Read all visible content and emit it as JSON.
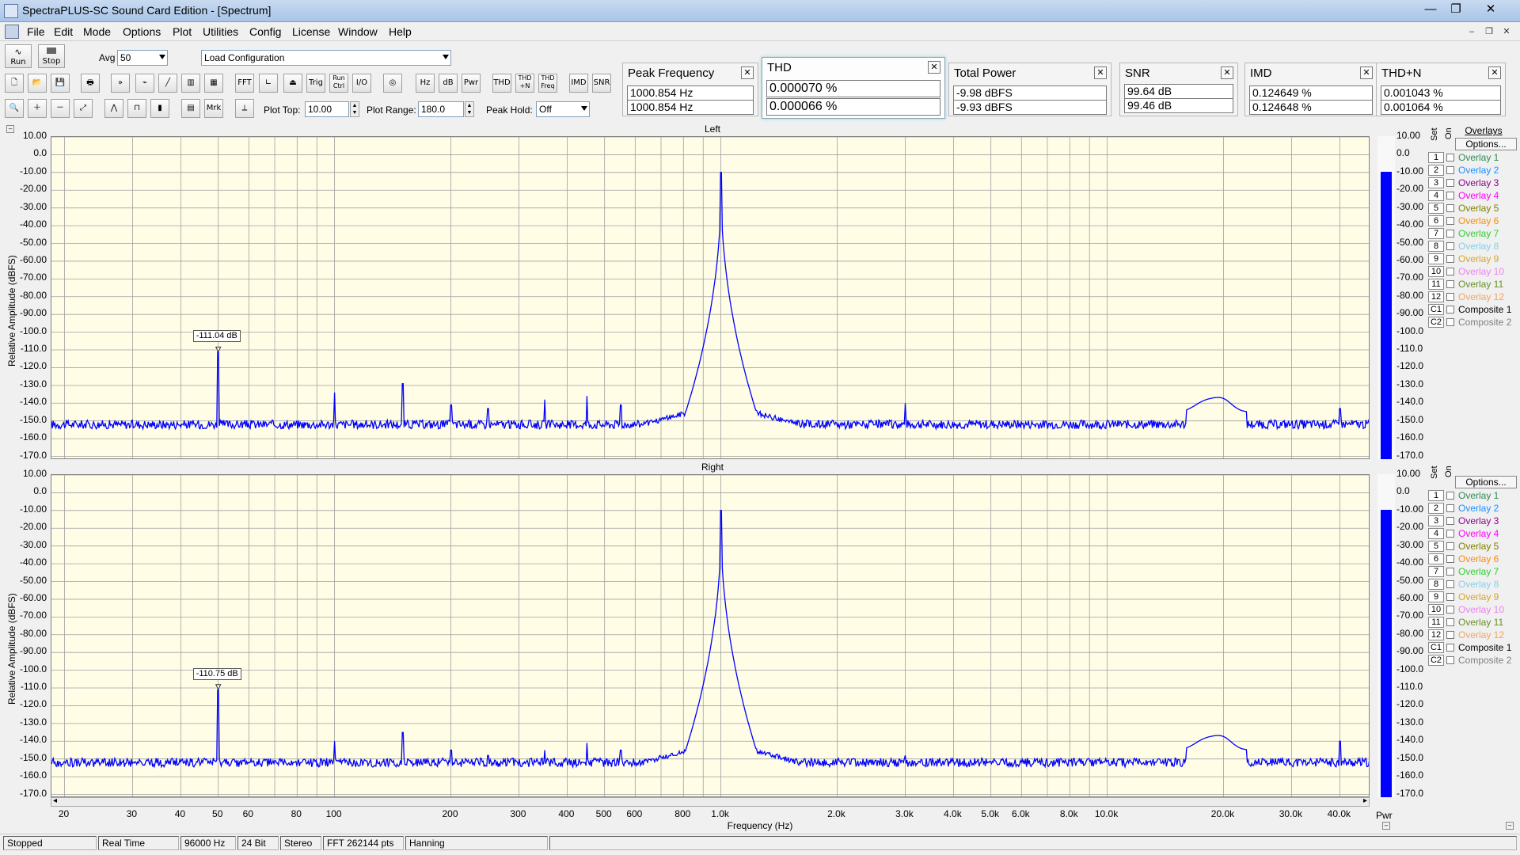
{
  "window": {
    "title": "SpectraPLUS-SC Sound Card Edition - [Spectrum]",
    "controls": [
      "—",
      "❐",
      "✕"
    ]
  },
  "menu": [
    "File",
    "Edit",
    "Mode",
    "Options",
    "Plot",
    "Utilities",
    "Config",
    "License",
    "Window",
    "Help"
  ],
  "toolbar": {
    "run_label": "Run",
    "stop_label": "Stop",
    "avg_label": "Avg",
    "avg_value": "50",
    "config_value": "Load Configuration",
    "fft_label": "FFT",
    "trig_label": "Trig",
    "runctrl_label": "Run Ctrl",
    "io_label": "I/O",
    "hz_label": "Hz",
    "db_label": "dB",
    "pwr_label": "Pwr",
    "thd_label": "THD",
    "thdn_label": "THD +N",
    "thdfreq_label": "THD Freq",
    "imd_label": "IMD",
    "snr_label": "SNR",
    "mrk_label": "Mrk",
    "plot_top_label": "Plot Top:",
    "plot_top_value": "10.00",
    "plot_range_label": "Plot Range:",
    "plot_range_value": "180.0",
    "peak_hold_label": "Peak Hold:",
    "peak_hold_value": "Off"
  },
  "meters": [
    {
      "title": "Peak Frequency",
      "v1": "1000.854 Hz",
      "v2": "1000.854 Hz"
    },
    {
      "title": "THD",
      "v1": "0.000070 %",
      "v2": "0.000066 %"
    },
    {
      "title": "Total Power",
      "v1": "-9.98 dBFS",
      "v2": "-9.93 dBFS"
    },
    {
      "title": "SNR",
      "v1": "99.64 dB",
      "v2": "99.46 dB"
    },
    {
      "title": "IMD",
      "v1": "0.124649 %",
      "v2": "0.124648 %"
    },
    {
      "title": "THD+N",
      "v1": "0.001043 %",
      "v2": "0.001064 %"
    }
  ],
  "plots": [
    {
      "title": "Left",
      "ylabel": "Relative Amplitude (dBFS)",
      "marker": "-111.04 dB",
      "marker_db": -111.04,
      "pwr_level_db": -10
    },
    {
      "title": "Right",
      "ylabel": "Relative Amplitude (dBFS)",
      "marker": "-110.75 dB",
      "marker_db": -110.75,
      "pwr_level_db": -10
    }
  ],
  "yticks": [
    "10.00",
    "0.0",
    "-10.00",
    "-20.00",
    "-30.00",
    "-40.00",
    "-50.00",
    "-60.00",
    "-70.00",
    "-80.00",
    "-90.00",
    "-100.0",
    "-110.0",
    "-120.0",
    "-130.0",
    "-140.0",
    "-150.0",
    "-160.0",
    "-170.0"
  ],
  "pwr_ticks": [
    "10.00",
    "0.0",
    "-10.00",
    "-20.00",
    "-30.00",
    "-40.00",
    "-50.00",
    "-60.00",
    "-70.00",
    "-80.00",
    "-90.00",
    "-100.0",
    "-110.0",
    "-120.0",
    "-130.0",
    "-140.0",
    "-150.0",
    "-160.0",
    "-170.0"
  ],
  "xticks": [
    {
      "label": "20",
      "f": 20
    },
    {
      "label": "30",
      "f": 30
    },
    {
      "label": "40",
      "f": 40
    },
    {
      "label": "50",
      "f": 50
    },
    {
      "label": "60",
      "f": 60
    },
    {
      "label": "80",
      "f": 80
    },
    {
      "label": "100",
      "f": 100
    },
    {
      "label": "200",
      "f": 200
    },
    {
      "label": "300",
      "f": 300
    },
    {
      "label": "400",
      "f": 400
    },
    {
      "label": "500",
      "f": 500
    },
    {
      "label": "600",
      "f": 600
    },
    {
      "label": "800",
      "f": 800
    },
    {
      "label": "1.0k",
      "f": 1000
    },
    {
      "label": "2.0k",
      "f": 2000
    },
    {
      "label": "3.0k",
      "f": 3000
    },
    {
      "label": "4.0k",
      "f": 4000
    },
    {
      "label": "5.0k",
      "f": 5000
    },
    {
      "label": "6.0k",
      "f": 6000
    },
    {
      "label": "8.0k",
      "f": 8000
    },
    {
      "label": "10.0k",
      "f": 10000
    },
    {
      "label": "20.0k",
      "f": 20000
    },
    {
      "label": "30.0k",
      "f": 30000
    },
    {
      "label": "40.0k",
      "f": 40000
    }
  ],
  "xlabel": "Frequency (Hz)",
  "pwr_label": "Pwr",
  "overlay_header": {
    "set": "Set",
    "on": "On",
    "title": "Overlays",
    "options": "Options..."
  },
  "overlays": [
    {
      "num": "1",
      "label": "Overlay 1",
      "color": "#2e8b57"
    },
    {
      "num": "2",
      "label": "Overlay 2",
      "color": "#1e90ff"
    },
    {
      "num": "3",
      "label": "Overlay 3",
      "color": "#8b008b"
    },
    {
      "num": "4",
      "label": "Overlay 4",
      "color": "#ff00ff"
    },
    {
      "num": "5",
      "label": "Overlay 5",
      "color": "#808000"
    },
    {
      "num": "6",
      "label": "Overlay 6",
      "color": "#ff8c00"
    },
    {
      "num": "7",
      "label": "Overlay 7",
      "color": "#32cd32"
    },
    {
      "num": "8",
      "label": "Overlay 8",
      "color": "#87ceeb"
    },
    {
      "num": "9",
      "label": "Overlay 9",
      "color": "#daa520"
    },
    {
      "num": "10",
      "label": "Overlay 10",
      "color": "#ee82ee"
    },
    {
      "num": "11",
      "label": "Overlay 11",
      "color": "#6b8e23"
    },
    {
      "num": "12",
      "label": "Overlay 12",
      "color": "#f4a460"
    },
    {
      "num": "C1",
      "label": "Composite 1",
      "color": "#000000"
    },
    {
      "num": "C2",
      "label": "Composite 2",
      "color": "#808080"
    }
  ],
  "status": [
    "Stopped",
    "Real Time",
    "96000 Hz",
    "24 Bit",
    "Stereo",
    "FFT 262144 pts",
    "Hanning"
  ],
  "colors": {
    "trace": "#0000ff",
    "plot_bg": "#fffde6",
    "grid": "#a0a0a0"
  },
  "spectrum": {
    "noise_floor_db": -152,
    "fundamental_hz": 1000.854,
    "fundamental_db": -10,
    "spurs_left": [
      {
        "f": 50,
        "db": -111
      },
      {
        "f": 100,
        "db": -134
      },
      {
        "f": 150,
        "db": -129
      },
      {
        "f": 200,
        "db": -141
      },
      {
        "f": 250,
        "db": -143
      },
      {
        "f": 350,
        "db": -138
      },
      {
        "f": 450,
        "db": -136
      },
      {
        "f": 550,
        "db": -141
      },
      {
        "f": 3000,
        "db": -140
      },
      {
        "f": 40000,
        "db": -143
      }
    ],
    "spurs_right": [
      {
        "f": 50,
        "db": -111
      },
      {
        "f": 100,
        "db": -140
      },
      {
        "f": 150,
        "db": -135
      },
      {
        "f": 200,
        "db": -145
      },
      {
        "f": 250,
        "db": -148
      },
      {
        "f": 350,
        "db": -145
      },
      {
        "f": 450,
        "db": -141
      },
      {
        "f": 550,
        "db": -145
      },
      {
        "f": 3000,
        "db": -148
      },
      {
        "f": 40000,
        "db": -140
      }
    ]
  }
}
